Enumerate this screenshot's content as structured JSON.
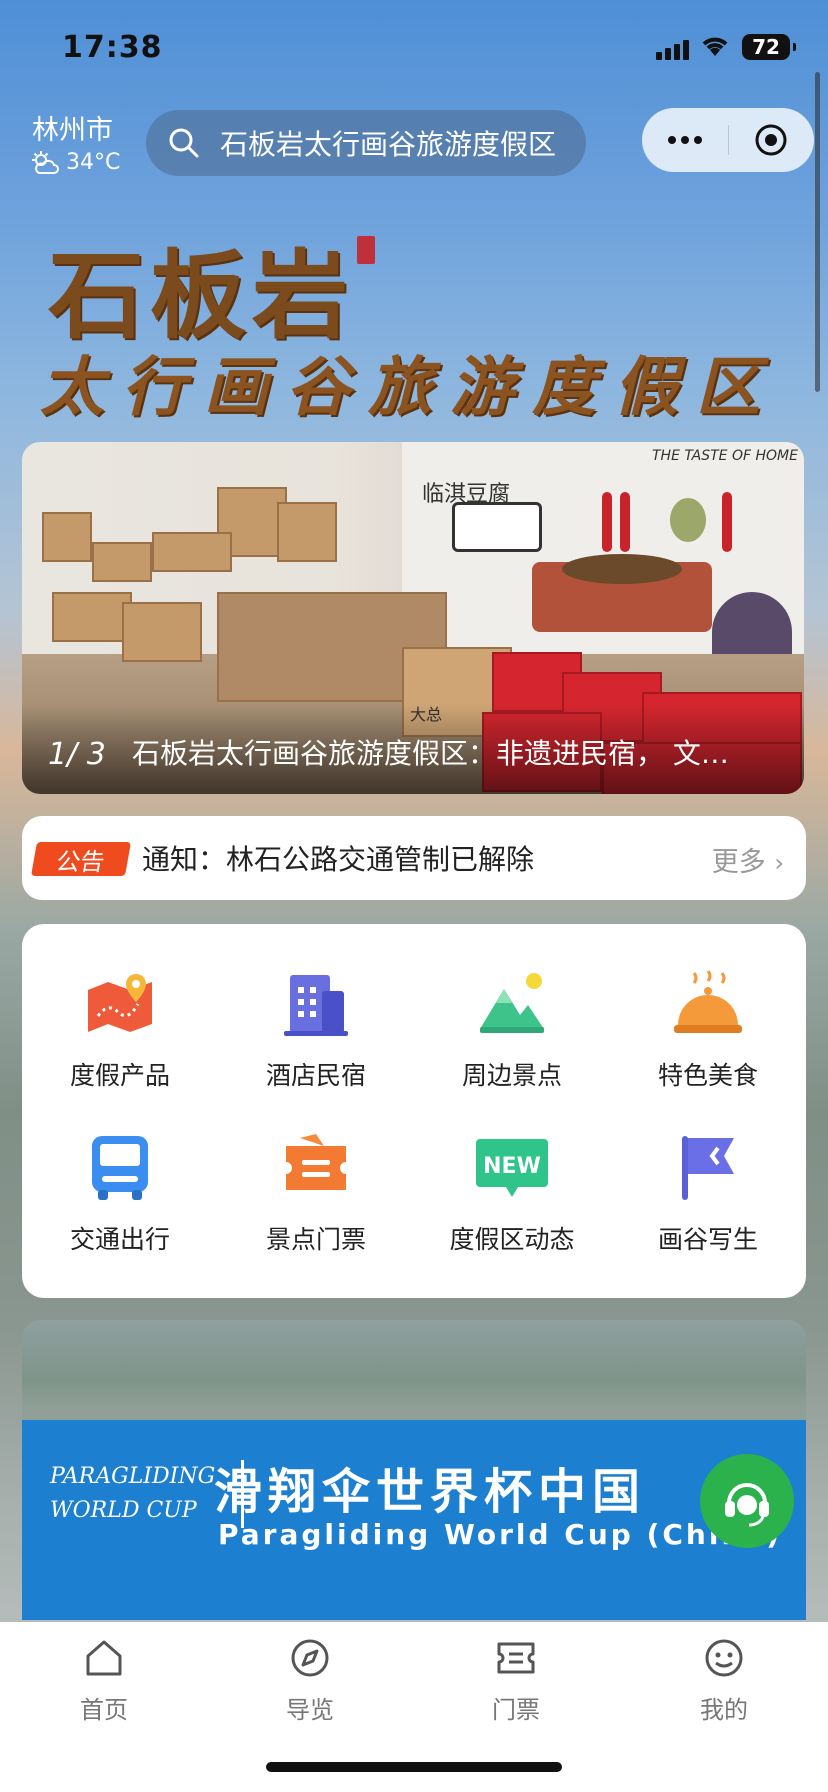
{
  "status_bar": {
    "time": "17:38",
    "battery": "72"
  },
  "header": {
    "city": "林州市",
    "temperature": "34°C",
    "search_text": "石板岩太行画谷旅游度假区"
  },
  "logo": {
    "line1": "石板岩",
    "line2": "太行画谷旅游度假区"
  },
  "banner": {
    "index": "1/ 3",
    "title": "石板岩太行画谷旅游度假区：非遗进民宿， 文…",
    "box_label": "大总",
    "wall_text": "THE TASTE OF HOME",
    "wall_sign": "临淇豆腐"
  },
  "notice": {
    "tag": "公告",
    "text": "通知：林石公路交通管制已解除",
    "more": "更多"
  },
  "grid": {
    "items": [
      {
        "label": "度假产品",
        "icon": "map-pin-icon"
      },
      {
        "label": "酒店民宿",
        "icon": "building-icon"
      },
      {
        "label": "周边景点",
        "icon": "mountain-icon"
      },
      {
        "label": "特色美食",
        "icon": "food-dome-icon"
      },
      {
        "label": "交通出行",
        "icon": "bus-icon"
      },
      {
        "label": "景点门票",
        "icon": "ticket-icon"
      },
      {
        "label": "度假区动态",
        "icon": "new-badge-icon"
      },
      {
        "label": "画谷写生",
        "icon": "flag-icon"
      }
    ]
  },
  "promo": {
    "logo_line1": "PARAGLIDING",
    "logo_line2": "WORLD CUP",
    "title_cn": "滑翔伞世界杯中国",
    "title_en": "Paragliding World Cup (China)"
  },
  "tabbar": {
    "items": [
      {
        "label": "首页",
        "icon": "home-icon"
      },
      {
        "label": "导览",
        "icon": "compass-icon"
      },
      {
        "label": "门票",
        "icon": "ticket-icon"
      },
      {
        "label": "我的",
        "icon": "smile-icon"
      }
    ]
  },
  "colors": {
    "accent_orange": "#f04a1f",
    "service_green": "#2bb24c",
    "promo_blue": "#1d7fd0"
  }
}
